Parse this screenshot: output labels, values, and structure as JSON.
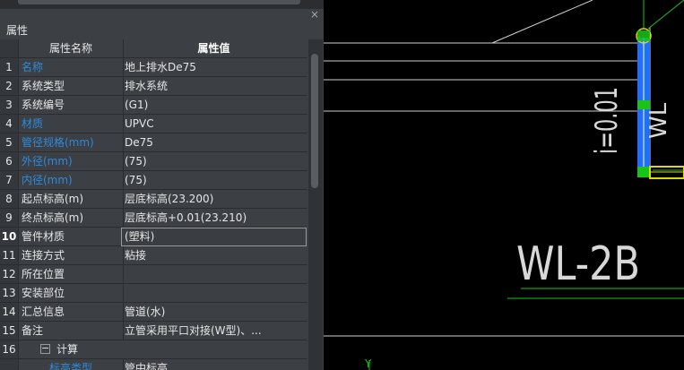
{
  "panel": {
    "title": "属性",
    "close_label": "×",
    "header": {
      "name": "属性名称",
      "value": "属性值"
    },
    "rows": [
      {
        "num": "1",
        "name": "名称",
        "value": "地上排水De75",
        "blue": true
      },
      {
        "num": "2",
        "name": "系统类型",
        "value": "排水系统",
        "blue": false
      },
      {
        "num": "3",
        "name": "系统编号",
        "value": "(G1)",
        "blue": false
      },
      {
        "num": "4",
        "name": "材质",
        "value": "UPVC",
        "blue": true
      },
      {
        "num": "5",
        "name": "管径规格(mm)",
        "value": "De75",
        "blue": true
      },
      {
        "num": "6",
        "name": "外径(mm)",
        "value": "(75)",
        "blue": true
      },
      {
        "num": "7",
        "name": "内径(mm)",
        "value": "(75)",
        "blue": true
      },
      {
        "num": "8",
        "name": "起点标高(m)",
        "value": "层底标高(23.200)",
        "blue": false
      },
      {
        "num": "9",
        "name": "终点标高(m)",
        "value": "层底标高+0.01(23.210)",
        "blue": false
      },
      {
        "num": "10",
        "name": "管件材质",
        "value": "(塑料)",
        "blue": false,
        "selected": true
      },
      {
        "num": "11",
        "name": "连接方式",
        "value": "粘接",
        "blue": false
      },
      {
        "num": "12",
        "name": "所在位置",
        "value": "",
        "blue": false
      },
      {
        "num": "13",
        "name": "安装部位",
        "value": "",
        "blue": false
      },
      {
        "num": "14",
        "name": "汇总信息",
        "value": "管道(水)",
        "blue": false
      },
      {
        "num": "15",
        "name": "备注",
        "value": "立管采用平口对接(W型)、...",
        "blue": false
      }
    ],
    "group": {
      "num": "16",
      "toggle": "−",
      "label": "计算"
    },
    "sub_row": {
      "name": "标高类型",
      "value": "管中标高"
    }
  },
  "cad": {
    "label_main": "WL-2B",
    "label_slope": "i=0.01",
    "label_vertical": "WL",
    "axis_y": "Y",
    "colors": {
      "line_white": "#d8d8d8",
      "green": "#19c419",
      "pipe_blue": "#1f6fff",
      "yellow": "#e0d800"
    }
  }
}
